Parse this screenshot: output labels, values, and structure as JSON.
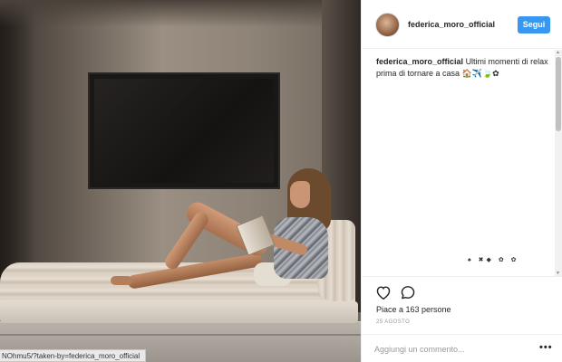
{
  "post": {
    "username": "federica_moro_official",
    "follow_label": "Segui",
    "caption_user": "federica_moro_official",
    "caption_text": "Ultimi momenti di relax prima di tornare a casa 🏠✈️🍃✿",
    "emoji_strip": "♠ ✖◆ ✿ ✿",
    "likes_text": "Piace a 163 persone",
    "date": "25 AGOSTO",
    "comment_placeholder": "Aggiungi un commento...",
    "more_label": "•••"
  },
  "photo": {
    "description_alt": "",
    "status_url": "NOhmu5/?taken-by=federica_moro_official"
  },
  "icons": {
    "like": "heart-icon",
    "comment": "comment-bubble-icon",
    "more": "more-options-icon"
  },
  "colors": {
    "follow_button": "#3897f0",
    "text": "#262626",
    "muted": "#999999",
    "divider": "#efefef"
  }
}
